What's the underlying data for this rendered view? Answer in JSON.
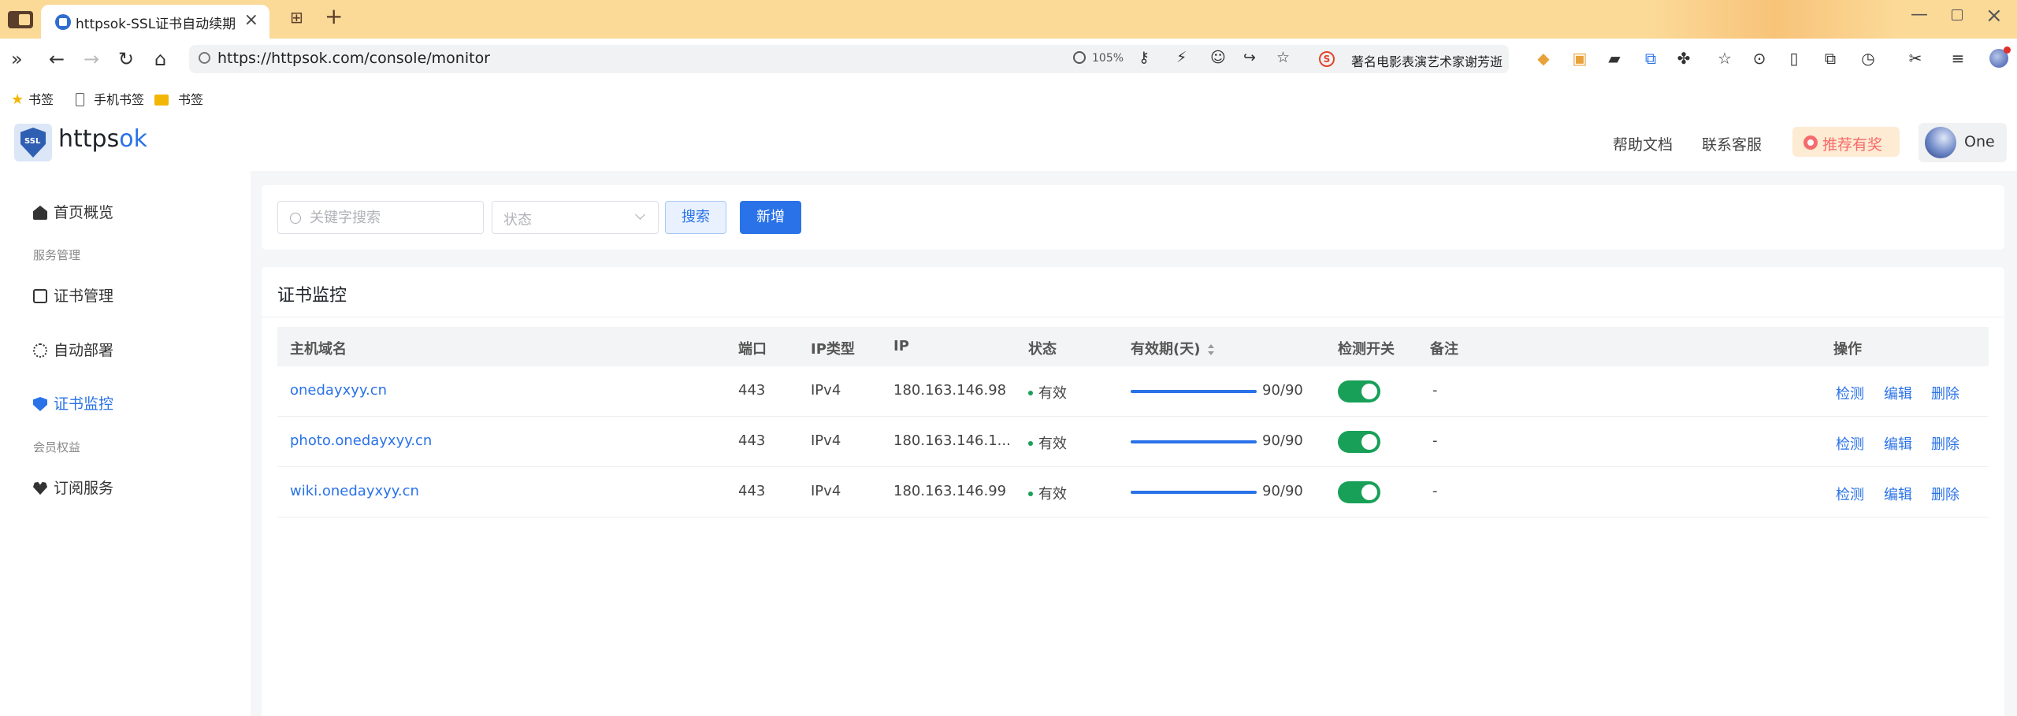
{
  "browser": {
    "tab_title": "httpsok-SSL证书自动续期",
    "url": "https://httpsok.com/console/monitor",
    "zoom": "105%",
    "search_suggest": "著名电影表演艺术家谢芳逝",
    "bookmarks": [
      "书签",
      "手机书签",
      "书签"
    ]
  },
  "header": {
    "logo_text": "https",
    "logo_text_accent": "ok",
    "logo_badge": "SSL",
    "help_docs": "帮助文档",
    "contact": "联系客服",
    "recommend": "推荐有奖",
    "user_name": "One"
  },
  "sidebar": {
    "items": [
      {
        "label": "首页概览",
        "icon": "home-icon"
      },
      {
        "group": "服务管理"
      },
      {
        "label": "证书管理",
        "icon": "certificate-icon"
      },
      {
        "label": "自动部署",
        "icon": "deploy-icon"
      },
      {
        "label": "证书监控",
        "icon": "shield-icon",
        "active": true
      },
      {
        "group": "会员权益"
      },
      {
        "label": "订阅服务",
        "icon": "heart-icon"
      }
    ]
  },
  "filter": {
    "keyword_placeholder": "关键字搜索",
    "status_placeholder": "状态",
    "search_button": "搜索",
    "add_button": "新增"
  },
  "table": {
    "title": "证书监控",
    "columns": [
      "主机域名",
      "端口",
      "IP类型",
      "IP",
      "状态",
      "有效期(天)",
      "检测开关",
      "备注",
      "操作"
    ],
    "rows": [
      {
        "domain": "onedayxyy.cn",
        "port": "443",
        "ip_type": "IPv4",
        "ip": "180.163.146.98",
        "status": "有效",
        "validity": "90/90",
        "validity_fraction": 1.0,
        "monitor_on": true,
        "note": "-"
      },
      {
        "domain": "photo.onedayxyy.cn",
        "port": "443",
        "ip_type": "IPv4",
        "ip": "180.163.146.1...",
        "status": "有效",
        "validity": "90/90",
        "validity_fraction": 1.0,
        "monitor_on": true,
        "note": "-"
      },
      {
        "domain": "wiki.onedayxyy.cn",
        "port": "443",
        "ip_type": "IPv4",
        "ip": "180.163.146.99",
        "status": "有效",
        "validity": "90/90",
        "validity_fraction": 1.0,
        "monitor_on": true,
        "note": "-"
      }
    ],
    "actions": [
      "检测",
      "编辑",
      "删除"
    ]
  },
  "colors": {
    "accent": "#2a72e8",
    "success": "#18a058",
    "tabbar": "#fbd997"
  }
}
